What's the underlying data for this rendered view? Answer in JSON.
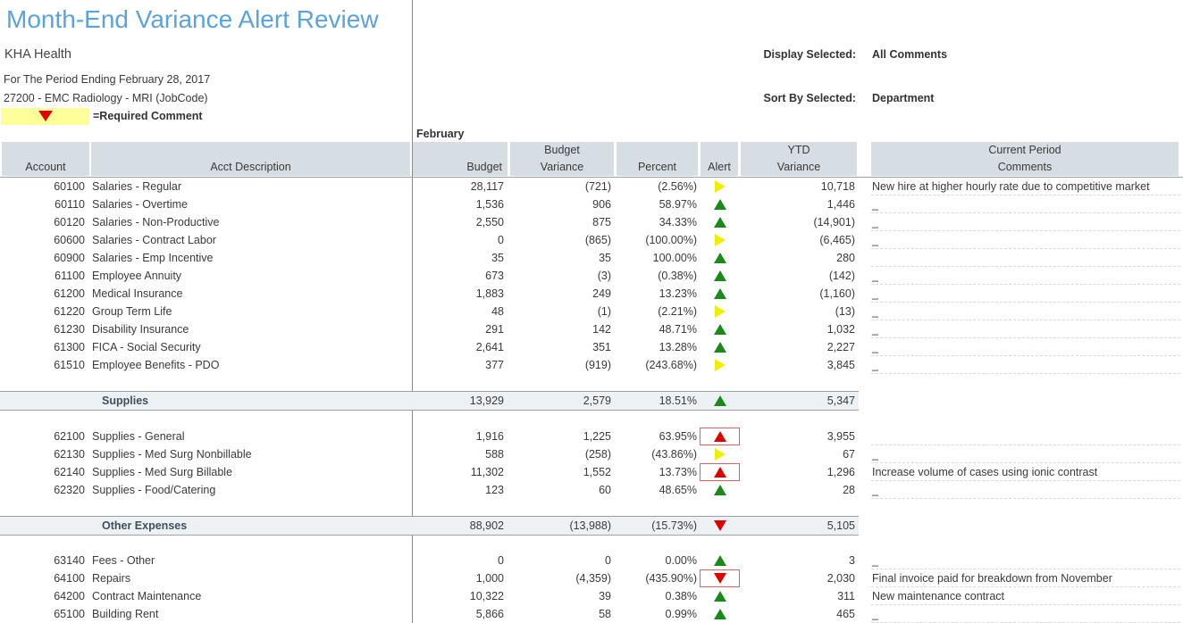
{
  "report": {
    "title": "Month-End Variance Alert Review",
    "organization": "KHA Health",
    "period": "For The Period Ending February 28, 2017",
    "job_code": "27200 - EMC Radiology - MRI (JobCode)",
    "legend_text": "=Required Comment",
    "display_label": "Display Selected:",
    "display_value": "All Comments",
    "sort_label": "Sort By Selected:",
    "sort_value": "Department",
    "month": "February"
  },
  "columns": {
    "account": "Account",
    "description": "Acct Description",
    "budget": "Budget",
    "budget_variance_1": "Budget",
    "budget_variance_2": "Variance",
    "percent": "Percent",
    "alert": "Alert",
    "ytd_1": "YTD",
    "ytd_2": "Variance",
    "comments_1": "Current Period",
    "comments_2": "Comments"
  },
  "colors": {
    "title": "#5ba3dc",
    "header_bg": "#d6dde3",
    "alert_green": "#1a8a1a",
    "alert_yellow": "#f0ee00",
    "alert_red": "#e00000",
    "legend_bg": "#ffff99"
  },
  "rows": [
    {
      "account": "60100",
      "desc": "Salaries - Regular",
      "budget": "28,117",
      "variance": "(721)",
      "percent": "(2.56%)",
      "alert": "right-yellow",
      "boxed": false,
      "ytd": "10,718",
      "comment": "New hire at higher hourly rate due to competitive market"
    },
    {
      "account": "60110",
      "desc": "Salaries - Overtime",
      "budget": "1,536",
      "variance": "906",
      "percent": "58.97%",
      "alert": "up-green",
      "boxed": false,
      "ytd": "1,446",
      "comment": "_"
    },
    {
      "account": "60120",
      "desc": "Salaries - Non-Productive",
      "budget": "2,550",
      "variance": "875",
      "percent": "34.33%",
      "alert": "up-green",
      "boxed": false,
      "ytd": "(14,901)",
      "comment": "_"
    },
    {
      "account": "60600",
      "desc": "Salaries - Contract Labor",
      "budget": "0",
      "variance": "(865)",
      "percent": "(100.00%)",
      "alert": "right-yellow",
      "boxed": false,
      "ytd": "(6,465)",
      "comment": "_"
    },
    {
      "account": "60900",
      "desc": "Salaries - Emp Incentive",
      "budget": "35",
      "variance": "35",
      "percent": "100.00%",
      "alert": "up-green",
      "boxed": false,
      "ytd": "280",
      "comment": ""
    },
    {
      "account": "61100",
      "desc": "Employee Annuity",
      "budget": "673",
      "variance": "(3)",
      "percent": "(0.38%)",
      "alert": "up-green",
      "boxed": false,
      "ytd": "(142)",
      "comment": "_"
    },
    {
      "account": "61200",
      "desc": "Medical Insurance",
      "budget": "1,883",
      "variance": "249",
      "percent": "13.23%",
      "alert": "up-green",
      "boxed": false,
      "ytd": "(1,160)",
      "comment": "_"
    },
    {
      "account": "61220",
      "desc": "Group Term Life",
      "budget": "48",
      "variance": "(1)",
      "percent": "(2.21%)",
      "alert": "right-yellow",
      "boxed": false,
      "ytd": "(13)",
      "comment": "_"
    },
    {
      "account": "61230",
      "desc": "Disability Insurance",
      "budget": "291",
      "variance": "142",
      "percent": "48.71%",
      "alert": "up-green",
      "boxed": false,
      "ytd": "1,032",
      "comment": "_"
    },
    {
      "account": "61300",
      "desc": "FICA - Social Security",
      "budget": "2,641",
      "variance": "351",
      "percent": "13.28%",
      "alert": "up-green",
      "boxed": false,
      "ytd": "2,227",
      "comment": "_"
    },
    {
      "account": "61510",
      "desc": "Employee Benefits - PDO",
      "budget": "377",
      "variance": "(919)",
      "percent": "(243.68%)",
      "alert": "right-yellow",
      "boxed": false,
      "ytd": "3,845",
      "comment": "_"
    }
  ],
  "group_supplies": {
    "name": "Supplies",
    "budget": "13,929",
    "variance": "2,579",
    "percent": "18.51%",
    "alert": "up-green",
    "ytd": "5,347"
  },
  "rows_supplies": [
    {
      "account": "62100",
      "desc": "Supplies - General",
      "budget": "1,916",
      "variance": "1,225",
      "percent": "63.95%",
      "alert": "up-red",
      "boxed": true,
      "ytd": "3,955",
      "comment": ""
    },
    {
      "account": "62130",
      "desc": "Supplies - Med Surg Nonbillable",
      "budget": "588",
      "variance": "(258)",
      "percent": "(43.86%)",
      "alert": "right-yellow",
      "boxed": false,
      "ytd": "67",
      "comment": "_"
    },
    {
      "account": "62140",
      "desc": "Supplies - Med Surg Billable",
      "budget": "11,302",
      "variance": "1,552",
      "percent": "13.73%",
      "alert": "up-red",
      "boxed": true,
      "ytd": "1,296",
      "comment": "Increase volume of cases using ionic contrast"
    },
    {
      "account": "62320",
      "desc": "Supplies - Food/Catering",
      "budget": "123",
      "variance": "60",
      "percent": "48.65%",
      "alert": "up-green",
      "boxed": false,
      "ytd": "28",
      "comment": "_"
    }
  ],
  "group_other": {
    "name": "Other Expenses",
    "budget": "88,902",
    "variance": "(13,988)",
    "percent": "(15.73%)",
    "alert": "down-red",
    "ytd": "5,105"
  },
  "rows_other": [
    {
      "account": "63140",
      "desc": "Fees - Other",
      "budget": "0",
      "variance": "0",
      "percent": "0.00%",
      "alert": "up-green",
      "boxed": false,
      "ytd": "3",
      "comment": "_"
    },
    {
      "account": "64100",
      "desc": "Repairs",
      "budget": "1,000",
      "variance": "(4,359)",
      "percent": "(435.90%)",
      "alert": "down-red",
      "boxed": true,
      "ytd": "2,030",
      "comment": "Final invoice paid for breakdown from November"
    },
    {
      "account": "64200",
      "desc": "Contract Maintenance",
      "budget": "10,322",
      "variance": "39",
      "percent": "0.38%",
      "alert": "up-green",
      "boxed": false,
      "ytd": "311",
      "comment": "New maintenance contract"
    },
    {
      "account": "65100",
      "desc": "Building Rent",
      "budget": "5,866",
      "variance": "58",
      "percent": "0.99%",
      "alert": "up-green",
      "boxed": false,
      "ytd": "465",
      "comment": "_"
    }
  ]
}
